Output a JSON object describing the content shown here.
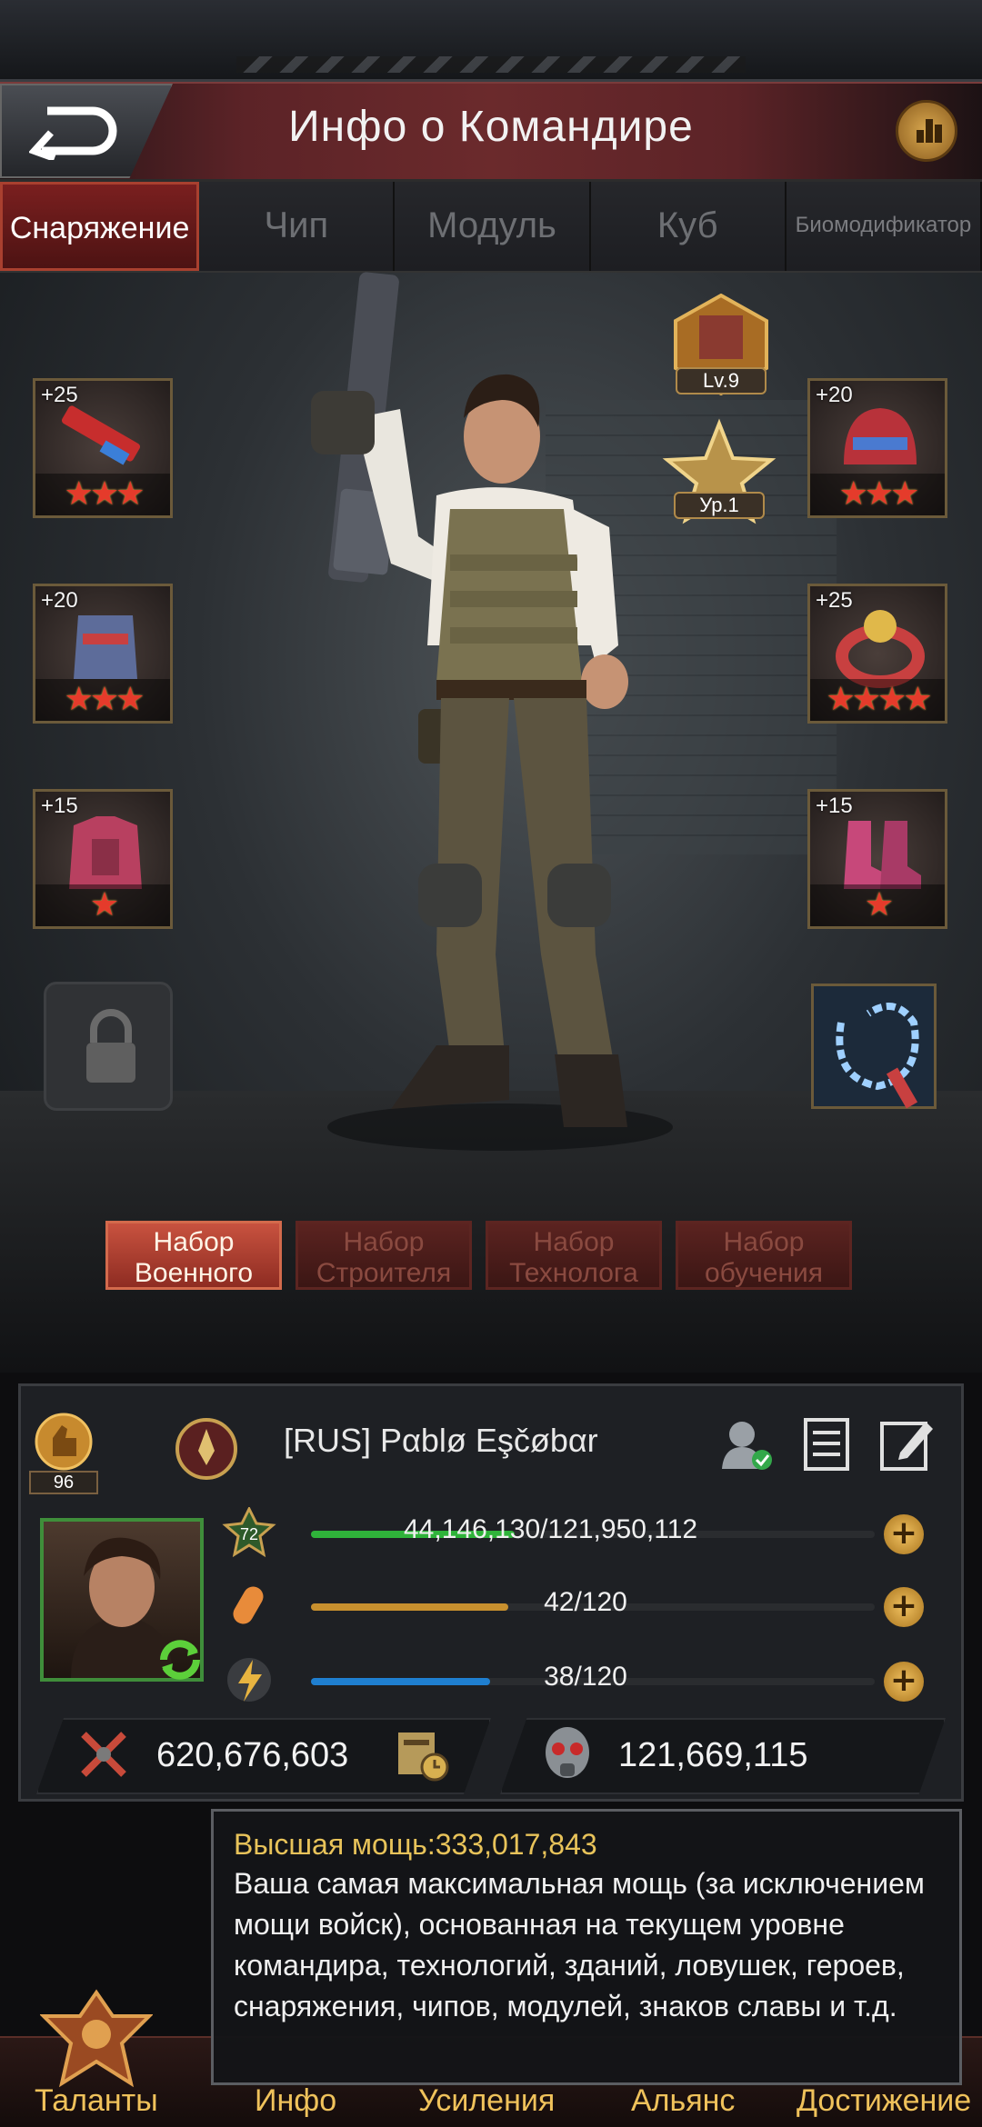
{
  "header": {
    "title": "Инфо о Командире",
    "back_icon": "back-arrow-icon",
    "stats_icon": "bar-chart-icon"
  },
  "tabs": [
    {
      "label": "Снаряжение",
      "active": true
    },
    {
      "label": "Чип",
      "active": false
    },
    {
      "label": "Модуль",
      "active": false
    },
    {
      "label": "Куб",
      "active": false
    },
    {
      "label": "Биомодификатор",
      "active": false
    }
  ],
  "badges": {
    "level": "Lv.9",
    "rank": "Ур.1"
  },
  "equipment": {
    "weapon": {
      "level": "+25",
      "stars": "★★★",
      "star_count": 3
    },
    "gloves": {
      "level": "+20",
      "stars": "★★★",
      "star_count": 3
    },
    "body": {
      "level": "+15",
      "stars": "★",
      "star_count": 1
    },
    "helmet": {
      "level": "+20",
      "stars": "★★★",
      "star_count": 3
    },
    "ring": {
      "level": "+25",
      "stars": "★★★★",
      "star_count": 4
    },
    "boots": {
      "level": "+15",
      "stars": "★",
      "star_count": 1
    }
  },
  "sets": [
    {
      "label": "Набор Военного",
      "active": true
    },
    {
      "label": "Набор Строителя",
      "active": false
    },
    {
      "label": "Набор Технолога",
      "active": false
    },
    {
      "label": "Набор обучения",
      "active": false
    }
  ],
  "profile": {
    "medal_value": "96",
    "name": "[RUS]  Pαblø Eşčøbαr",
    "level_badge": "72",
    "exp": {
      "text": "44,146,130/121,950,112",
      "fraction": 0.362
    },
    "stamina": {
      "text": "42/120",
      "fraction": 0.35
    },
    "energy": {
      "text": "38/120",
      "fraction": 0.317
    },
    "power": "620,676,603",
    "kills": "121,669,115"
  },
  "tooltip": {
    "title": "Высшая мощь:333,017,843",
    "body": "Ваша самая максимальная мощь (за исключением мощи войск), основанная на текущем уровне командира, технологий, зданий, ловушек, героев, снаряжения, чипов, модулей, знаков славы и т.д."
  },
  "nav": [
    "Таланты",
    "Инфо",
    "Усиления",
    "Альянс",
    "Достижение"
  ],
  "colors": {
    "accent_red": "#a9402f",
    "gold": "#e8c35a",
    "exp_bar": "#2fb33a",
    "stamina_bar": "#c8902e",
    "energy_bar": "#1f7fd0"
  }
}
